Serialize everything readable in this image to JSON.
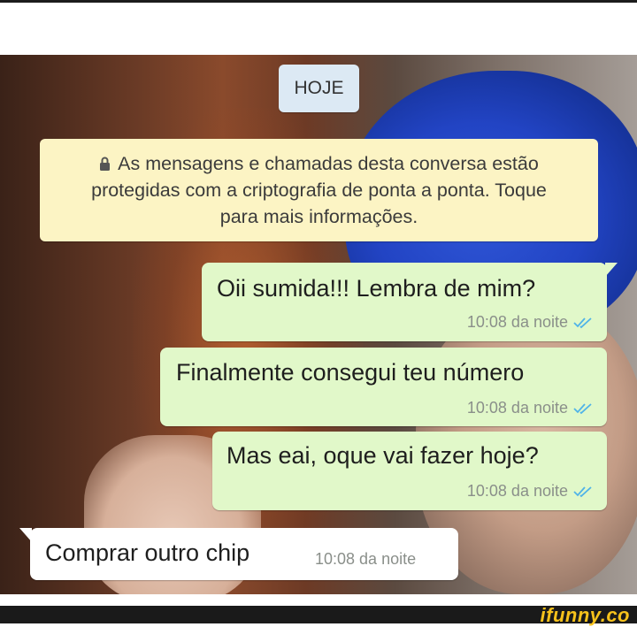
{
  "date_chip": {
    "label": "HOJE"
  },
  "encryption_notice": {
    "icon": "lock-icon",
    "text": "As mensagens e chamadas desta conversa estão protegidas com a criptografia de ponta a ponta. Toque para mais informações."
  },
  "messages": [
    {
      "direction": "outgoing",
      "text": "Oii sumida!!! Lembra de mim?",
      "time": "10:08 da noite",
      "status_icon": "double-check-icon"
    },
    {
      "direction": "outgoing",
      "text": "Finalmente consegui teu número",
      "time": "10:08 da noite",
      "status_icon": "double-check-icon"
    },
    {
      "direction": "outgoing",
      "text": "Mas eai, oque vai fazer hoje?",
      "time": "10:08 da noite",
      "status_icon": "double-check-icon"
    },
    {
      "direction": "incoming",
      "text": "Comprar outro chip",
      "time": "10:08 da noite"
    }
  ],
  "watermark": {
    "text": "ifunny.co"
  },
  "colors": {
    "outgoing_bubble": "#e1f8c9",
    "incoming_bubble": "#ffffff",
    "notice_bg": "#fcf4c4",
    "date_chip_bg": "#dce9f4",
    "tick_blue": "#4fb3e8",
    "watermark": "#f7c21b"
  }
}
